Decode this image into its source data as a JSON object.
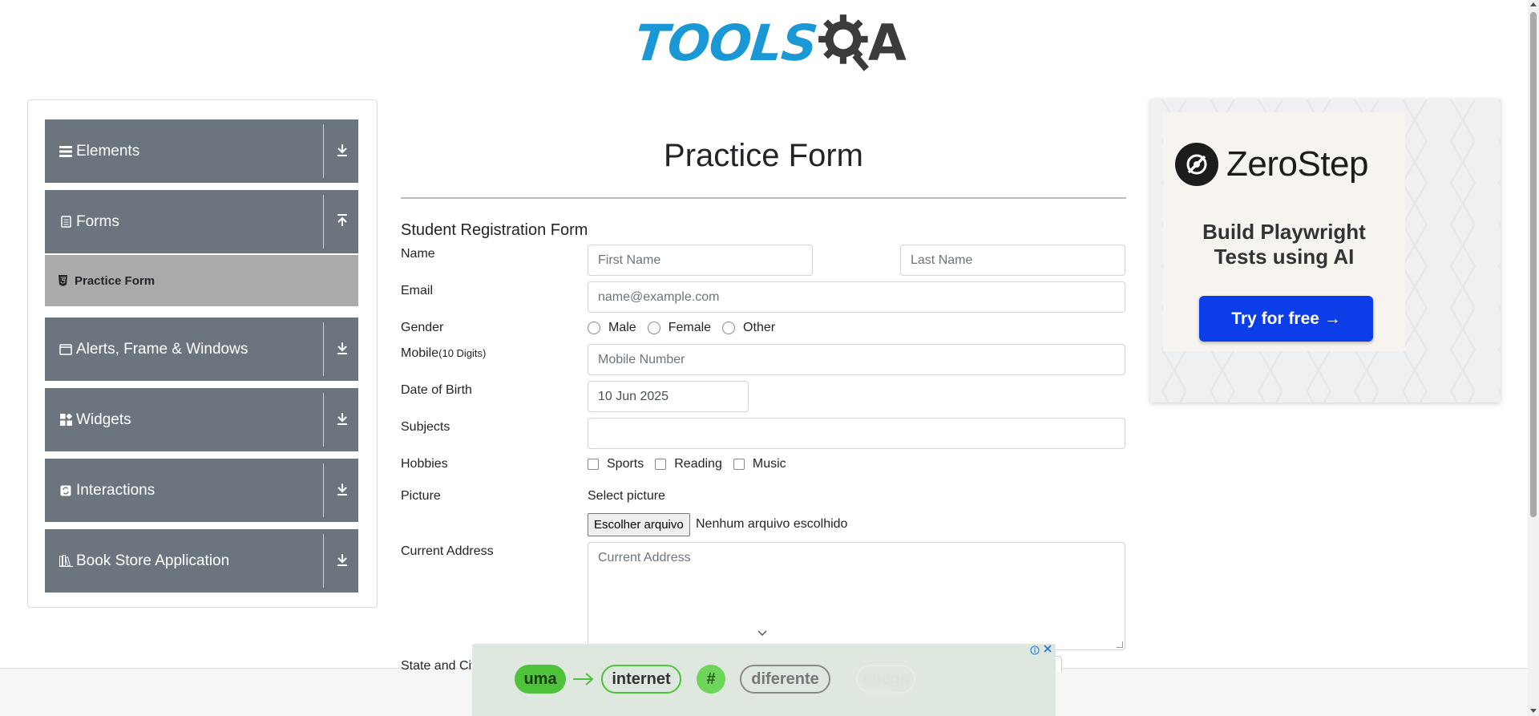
{
  "header": {
    "logo_text": "TOOLS",
    "logo_suffix": "A"
  },
  "sidebar": {
    "groups": [
      {
        "label": "Elements",
        "icon": "menu-icon"
      },
      {
        "label": "Forms",
        "icon": "document-icon"
      },
      {
        "label": "Alerts, Frame & Windows",
        "icon": "window-icon"
      },
      {
        "label": "Widgets",
        "icon": "widgets-icon"
      },
      {
        "label": "Interactions",
        "icon": "interactions-icon"
      },
      {
        "label": "Book Store Application",
        "icon": "books-icon"
      }
    ],
    "active_subitem": "Practice Form"
  },
  "form": {
    "page_title": "Practice Form",
    "form_title": "Student Registration Form",
    "name_label": "Name",
    "first_name_placeholder": "First Name",
    "last_name_placeholder": "Last Name",
    "email_label": "Email",
    "email_placeholder": "name@example.com",
    "gender_label": "Gender",
    "gender_options": [
      "Male",
      "Female",
      "Other"
    ],
    "mobile_label": "Mobile",
    "mobile_hint": "(10 Digits)",
    "mobile_placeholder": "Mobile Number",
    "dob_label": "Date of Birth",
    "dob_value": "10 Jun 2025",
    "subjects_label": "Subjects",
    "hobbies_label": "Hobbies",
    "hobby_options": [
      "Sports",
      "Reading",
      "Music"
    ],
    "picture_label": "Picture",
    "select_picture": "Select picture",
    "file_button": "Escolher arquivo",
    "file_status": "Nenhum arquivo escolhido",
    "address_label": "Current Address",
    "address_placeholder": "Current Address",
    "state_label": "State and City"
  },
  "right_ad": {
    "brand": "ZeroStep",
    "tagline_1": "Build Playwright",
    "tagline_2": "Tests using AI",
    "cta": "Try for free →"
  },
  "bottom_ad": {
    "words": [
      "uma",
      "internet",
      "#",
      "diferente",
      "chega"
    ]
  },
  "colors": {
    "sidebar_bg": "#6c757d",
    "active_item_bg": "#aaaaaa",
    "logo_blue": "#1a98d5",
    "cta_blue": "#0b3ee9"
  }
}
